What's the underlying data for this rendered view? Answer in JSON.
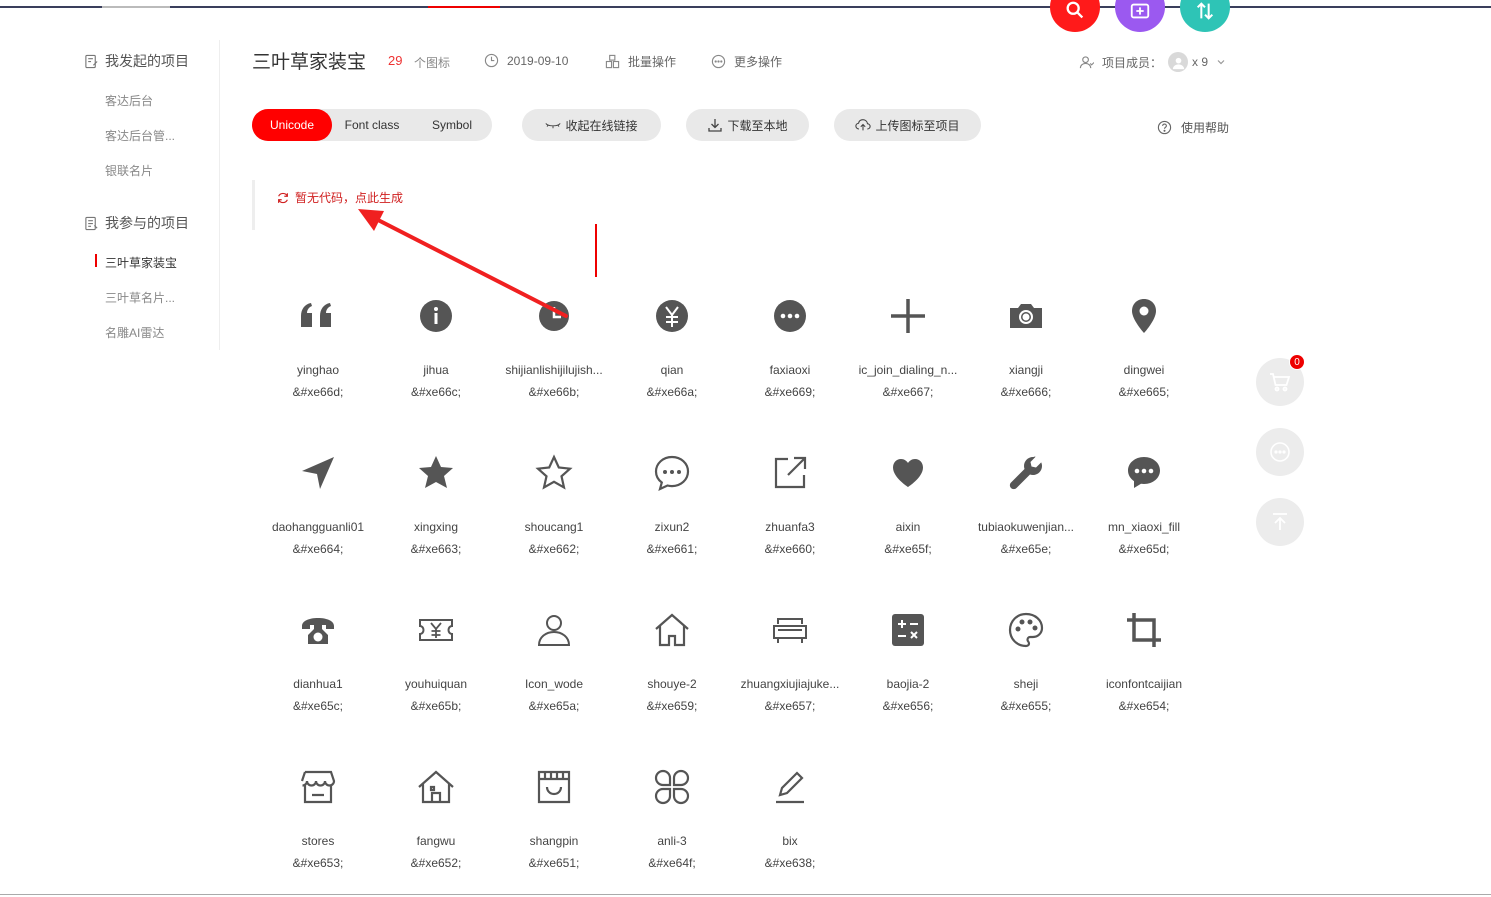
{
  "colors": {
    "accent": "#ff0000",
    "fab_search": "#ff1a1a",
    "fab_add": "#9b59f0",
    "fab_sort": "#2ec4b6"
  },
  "sidebar": {
    "created_heading": "我发起的项目",
    "created_items": [
      "客达后台",
      "客达后台管...",
      "银联名片"
    ],
    "joined_heading": "我参与的项目",
    "joined_items": [
      "三叶草家装宝",
      "三叶草名片...",
      "名雕AI雷达"
    ]
  },
  "header": {
    "project_title": "三叶草家装宝",
    "icon_count": "29",
    "icon_count_label": "个图标",
    "date": "2019-09-10",
    "batch_ops": "批量操作",
    "more_ops": "更多操作",
    "members_label": "项目成员：",
    "members_count": "x 9"
  },
  "toolbar": {
    "tabs": [
      "Unicode",
      "Font class",
      "Symbol"
    ],
    "active_tab": "Unicode",
    "collapse_link": "收起在线链接",
    "download": "下载至本地",
    "upload": "上传图标至项目",
    "help": "使用帮助"
  },
  "code": {
    "empty_message": "暂无代码，点此生成"
  },
  "icons": [
    {
      "name": "yinghao",
      "code": "&#xe66d;",
      "icon": "quote-icon"
    },
    {
      "name": "jihua",
      "code": "&#xe66c;",
      "icon": "info-circle-icon"
    },
    {
      "name": "shijianlishijilujish...",
      "code": "&#xe66b;",
      "icon": "clock-icon"
    },
    {
      "name": "qian",
      "code": "&#xe66a;",
      "icon": "yen-circle-icon"
    },
    {
      "name": "faxiaoxi",
      "code": "&#xe669;",
      "icon": "more-circle-icon"
    },
    {
      "name": "ic_join_dialing_n...",
      "code": "&#xe667;",
      "icon": "plus-icon"
    },
    {
      "name": "xiangji",
      "code": "&#xe666;",
      "icon": "camera-icon"
    },
    {
      "name": "dingwei",
      "code": "&#xe665;",
      "icon": "location-pin-icon"
    },
    {
      "name": "daohangguanli01",
      "code": "&#xe664;",
      "icon": "navigation-arrow-icon"
    },
    {
      "name": "xingxing",
      "code": "&#xe663;",
      "icon": "star-filled-icon"
    },
    {
      "name": "shoucang1",
      "code": "&#xe662;",
      "icon": "star-outline-icon"
    },
    {
      "name": "zixun2",
      "code": "&#xe661;",
      "icon": "chat-bubble-icon"
    },
    {
      "name": "zhuanfa3",
      "code": "&#xe660;",
      "icon": "share-out-icon"
    },
    {
      "name": "aixin",
      "code": "&#xe65f;",
      "icon": "heart-icon"
    },
    {
      "name": "tubiaokuwenjian...",
      "code": "&#xe65e;",
      "icon": "wrench-icon"
    },
    {
      "name": "mn_xiaoxi_fill",
      "code": "&#xe65d;",
      "icon": "message-filled-icon"
    },
    {
      "name": "dianhua1",
      "code": "&#xe65c;",
      "icon": "telephone-icon"
    },
    {
      "name": "youhuiquan",
      "code": "&#xe65b;",
      "icon": "coupon-icon"
    },
    {
      "name": "Icon_wode",
      "code": "&#xe65a;",
      "icon": "user-icon"
    },
    {
      "name": "shouye-2",
      "code": "&#xe659;",
      "icon": "home-icon"
    },
    {
      "name": "zhuangxiujiajuke...",
      "code": "&#xe657;",
      "icon": "sofa-icon"
    },
    {
      "name": "baojia-2",
      "code": "&#xe656;",
      "icon": "calculator-icon"
    },
    {
      "name": "sheji",
      "code": "&#xe655;",
      "icon": "palette-icon"
    },
    {
      "name": "iconfontcaijian",
      "code": "&#xe654;",
      "icon": "crop-icon"
    },
    {
      "name": "stores",
      "code": "&#xe653;",
      "icon": "store-icon"
    },
    {
      "name": "fangwu",
      "code": "&#xe652;",
      "icon": "house-icon"
    },
    {
      "name": "shangpin",
      "code": "&#xe651;",
      "icon": "goods-icon"
    },
    {
      "name": "anli-3",
      "code": "&#xe64f;",
      "icon": "clover-icon"
    },
    {
      "name": "bix",
      "code": "&#xe638;",
      "icon": "edit-pen-icon"
    }
  ],
  "floating": {
    "cart_badge": "0"
  }
}
